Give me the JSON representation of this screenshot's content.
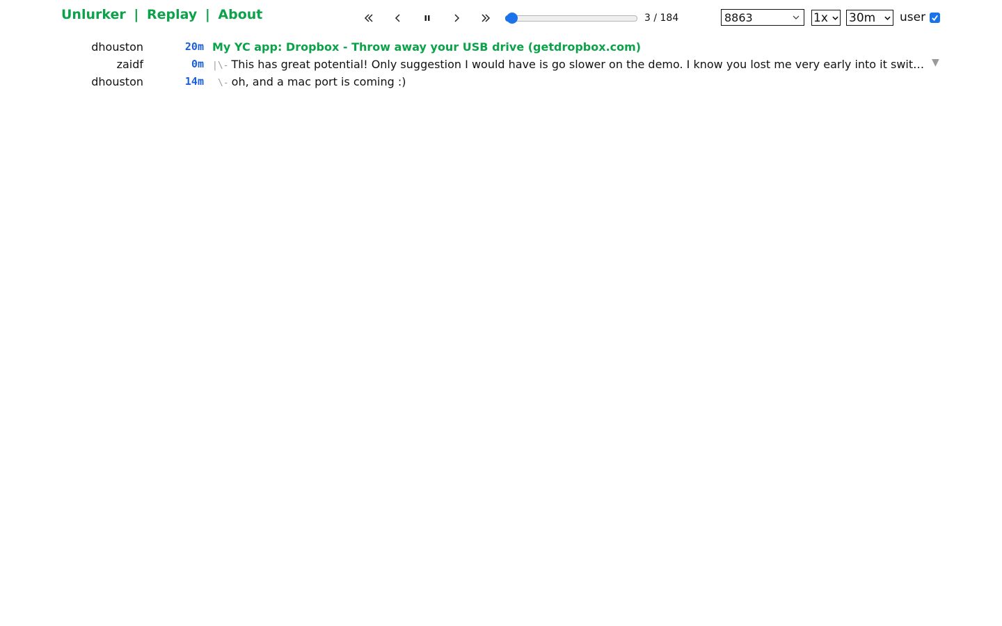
{
  "nav": {
    "unlurker": "Unlurker",
    "sep1": "|",
    "replay": "Replay",
    "sep2": "|",
    "about": "About"
  },
  "player": {
    "position": 3,
    "total": 184,
    "counter": "3 / 184",
    "accent": "#1a73e8",
    "icons": [
      "double-chevron-left-icon",
      "chevron-left-icon",
      "pause-icon",
      "chevron-right-icon",
      "double-chevron-right-icon"
    ]
  },
  "selects": {
    "story": "8863",
    "speed": "1x",
    "window": "30m"
  },
  "user_filter": {
    "label": "user",
    "checked": true
  },
  "colors": {
    "brand_green": "#0ba24a",
    "age_blue": "#1a5fd6",
    "muted": "#9a9a9a"
  },
  "rows": [
    {
      "author": "dhouston",
      "age": "20m",
      "tree": "",
      "text": "My YC app: Dropbox - Throw away your USB drive (getdropbox.com)"
    },
    {
      "author": "zaidf",
      "age": "0m",
      "tree": "|\\-",
      "text": "This has great potential! Only suggestion I would have is go slower on the demo. I know you lost me very early into it swit…",
      "expand": "▼"
    },
    {
      "author": "dhouston",
      "age": "14m",
      "tree": "\\-",
      "text": "oh, and a mac port is coming :)"
    }
  ]
}
